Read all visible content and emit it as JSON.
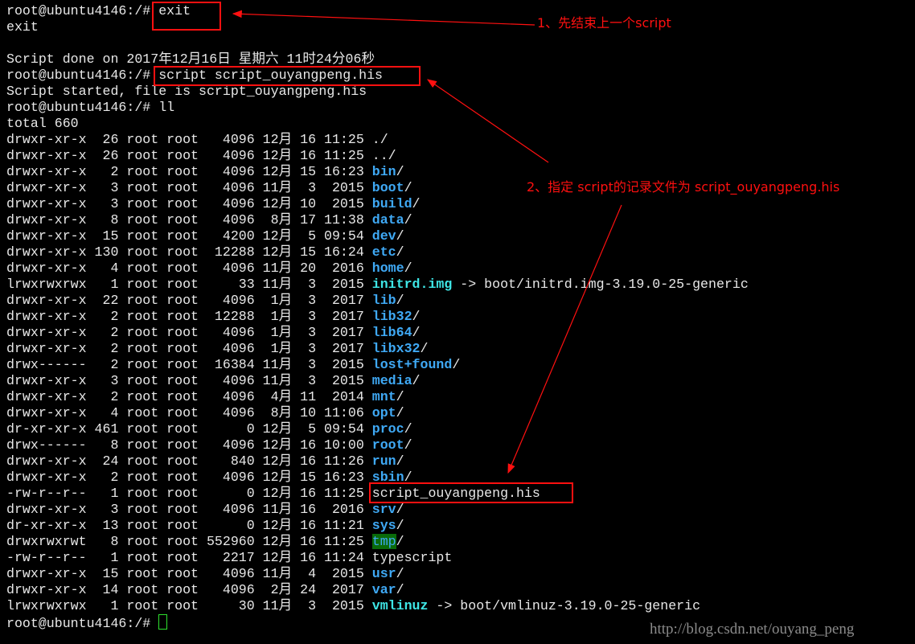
{
  "terminal": {
    "lines": [
      {
        "text": "root@ubuntu4146:/# exit"
      },
      {
        "text": "exit"
      },
      {
        "text": ""
      },
      {
        "text": "Script done on 2017年12月16日 星期六 11时24分06秒"
      },
      {
        "text": "root@ubuntu4146:/# script script_ouyangpeng.his"
      },
      {
        "text": "Script started, file is script_ouyangpeng.his"
      },
      {
        "text": "root@ubuntu4146:/# ll"
      },
      {
        "text": "total 660"
      },
      {
        "text": "drwxr-xr-x  26 root root   4096 12月 16 11:25 ",
        "name": "./",
        "kind": "plain"
      },
      {
        "text": "drwxr-xr-x  26 root root   4096 12月 16 11:25 ",
        "name": "../",
        "kind": "plain"
      },
      {
        "text": "drwxr-xr-x   2 root root   4096 12月 15 16:23 ",
        "name": "bin",
        "kind": "dir",
        "suffix": "/"
      },
      {
        "text": "drwxr-xr-x   3 root root   4096 11月  3  2015 ",
        "name": "boot",
        "kind": "dir",
        "suffix": "/"
      },
      {
        "text": "drwxr-xr-x   3 root root   4096 12月 10  2015 ",
        "name": "build",
        "kind": "dir",
        "suffix": "/"
      },
      {
        "text": "drwxr-xr-x   8 root root   4096  8月 17 11:38 ",
        "name": "data",
        "kind": "dir",
        "suffix": "/"
      },
      {
        "text": "drwxr-xr-x  15 root root   4200 12月  5 09:54 ",
        "name": "dev",
        "kind": "dir",
        "suffix": "/"
      },
      {
        "text": "drwxr-xr-x 130 root root  12288 12月 15 16:24 ",
        "name": "etc",
        "kind": "dir",
        "suffix": "/"
      },
      {
        "text": "drwxr-xr-x   4 root root   4096 11月 20  2016 ",
        "name": "home",
        "kind": "dir",
        "suffix": "/"
      },
      {
        "text": "lrwxrwxrwx   1 root root     33 11月  3  2015 ",
        "name": "initrd.img",
        "kind": "link",
        "suffix": " -> boot/initrd.img-3.19.0-25-generic"
      },
      {
        "text": "drwxr-xr-x  22 root root   4096  1月  3  2017 ",
        "name": "lib",
        "kind": "dir",
        "suffix": "/"
      },
      {
        "text": "drwxr-xr-x   2 root root  12288  1月  3  2017 ",
        "name": "lib32",
        "kind": "dir",
        "suffix": "/"
      },
      {
        "text": "drwxr-xr-x   2 root root   4096  1月  3  2017 ",
        "name": "lib64",
        "kind": "dir",
        "suffix": "/"
      },
      {
        "text": "drwxr-xr-x   2 root root   4096  1月  3  2017 ",
        "name": "libx32",
        "kind": "dir",
        "suffix": "/"
      },
      {
        "text": "drwx------   2 root root  16384 11月  3  2015 ",
        "name": "lost+found",
        "kind": "dir",
        "suffix": "/"
      },
      {
        "text": "drwxr-xr-x   3 root root   4096 11月  3  2015 ",
        "name": "media",
        "kind": "dir",
        "suffix": "/"
      },
      {
        "text": "drwxr-xr-x   2 root root   4096  4月 11  2014 ",
        "name": "mnt",
        "kind": "dir",
        "suffix": "/"
      },
      {
        "text": "drwxr-xr-x   4 root root   4096  8月 10 11:06 ",
        "name": "opt",
        "kind": "dir",
        "suffix": "/"
      },
      {
        "text": "dr-xr-xr-x 461 root root      0 12月  5 09:54 ",
        "name": "proc",
        "kind": "dir",
        "suffix": "/"
      },
      {
        "text": "drwx------   8 root root   4096 12月 16 10:00 ",
        "name": "root",
        "kind": "dir",
        "suffix": "/"
      },
      {
        "text": "drwxr-xr-x  24 root root    840 12月 16 11:26 ",
        "name": "run",
        "kind": "dir",
        "suffix": "/"
      },
      {
        "text": "drwxr-xr-x   2 root root   4096 12月 15 16:23 ",
        "name": "sbin",
        "kind": "dir",
        "suffix": "/"
      },
      {
        "text": "-rw-r--r--   1 root root      0 12月 16 11:25 ",
        "name": "script_ouyangpeng.his",
        "kind": "plain"
      },
      {
        "text": "drwxr-xr-x   3 root root   4096 11月 16  2016 ",
        "name": "srv",
        "kind": "dir",
        "suffix": "/"
      },
      {
        "text": "dr-xr-xr-x  13 root root      0 12月 16 11:21 ",
        "name": "sys",
        "kind": "dir",
        "suffix": "/"
      },
      {
        "text": "drwxrwxrwt   8 root root 552960 12月 16 11:25 ",
        "name": "tmp",
        "kind": "sticky",
        "suffix": "/"
      },
      {
        "text": "-rw-r--r--   1 root root   2217 12月 16 11:24 ",
        "name": "typescript",
        "kind": "plain"
      },
      {
        "text": "drwxr-xr-x  15 root root   4096 11月  4  2015 ",
        "name": "usr",
        "kind": "dir",
        "suffix": "/"
      },
      {
        "text": "drwxr-xr-x  14 root root   4096  2月 24  2017 ",
        "name": "var",
        "kind": "dir",
        "suffix": "/"
      },
      {
        "text": "lrwxrwxrwx   1 root root     30 11月  3  2015 ",
        "name": "vmlinuz",
        "kind": "link",
        "suffix": " -> boot/vmlinuz-3.19.0-25-generic"
      }
    ],
    "prompt": "root@ubuntu4146:/# "
  },
  "annotations": {
    "note1": "1、先结束上一个script",
    "note2": "2、指定 script的记录文件为 script_ouyangpeng.his",
    "color": "#ff1010"
  },
  "watermark": "http://blog.csdn.net/ouyang_peng"
}
